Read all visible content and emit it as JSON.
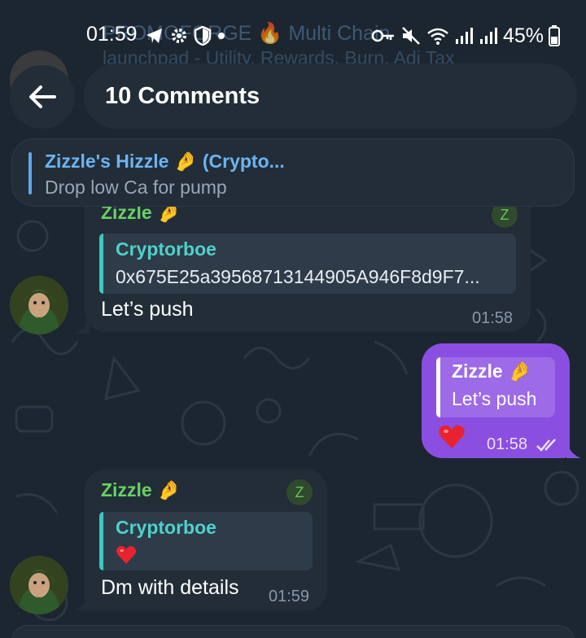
{
  "status_bar": {
    "time": "01:59",
    "battery": "45%",
    "icons_left": [
      "telegram-icon",
      "gear-icon",
      "shield-icon",
      "dot-icon"
    ],
    "icons_right": [
      "key-icon",
      "mute-icon",
      "wifi-icon",
      "signal-icon",
      "signal-icon",
      "battery-icon"
    ]
  },
  "background_channel": {
    "title": "PROMOFORGE 🔥 Multi Chain",
    "subtitle": "launchpad - Utility, Rewards, Burn, Adj Tax"
  },
  "header": {
    "back_icon": "arrow-left-icon",
    "title": "10 Comments"
  },
  "pinned": {
    "title": "Zizzle's Hizzle 🤌 (Crypto...",
    "text": "Drop low Ca for pump"
  },
  "messages": [
    {
      "sender": "Zizzle 🤌",
      "badge": "Z",
      "reply_to": {
        "name": "Cryptorboe",
        "text": "0x675E25a39568713144905A946F8d9F7..."
      },
      "text": "Let’s push",
      "time": "01:58"
    },
    {
      "outgoing": true,
      "reply_to": {
        "name": "Zizzle 🤌",
        "text": "Let’s push"
      },
      "reaction": "❤️",
      "time": "01:58",
      "status_icon": "double-check-icon"
    },
    {
      "sender": "Zizzle 🤌",
      "badge": "Z",
      "reply_to": {
        "name": "Cryptorboe",
        "text": "❤️"
      },
      "text": "Dm with details",
      "time": "01:59"
    }
  ],
  "colors": {
    "background": "#1c2630",
    "bubble_in": "#222d38",
    "bubble_out": "#8a4fe0",
    "sender_name": "#6ad163",
    "reply_name": "#4fd1cb",
    "link_blue": "#6cb4f2"
  }
}
